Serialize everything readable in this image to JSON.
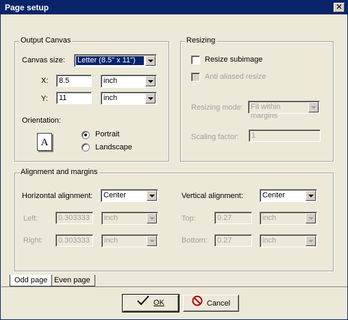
{
  "window": {
    "title": "Page setup",
    "close_glyph": "✕"
  },
  "output_canvas": {
    "legend": "Output Canvas",
    "canvas_size_label": "Canvas size:",
    "canvas_size_value": "Letter (8.5\" x 11\")",
    "x_label": "X:",
    "x_value": "8.5",
    "x_unit": "inch",
    "y_label": "Y:",
    "y_value": "11",
    "y_unit": "inch",
    "orientation_label": "Orientation:",
    "page_icon_letter": "A",
    "portrait_label": "Portrait",
    "landscape_label": "Landscape",
    "portrait_checked": true
  },
  "resizing": {
    "legend": "Resizing",
    "resize_subimage_label": "Resize subimage",
    "anti_aliased_label": "Anti aliased resize",
    "mode_label": "Resizing mode:",
    "mode_value": "Fit within margins",
    "scaling_label": "Scaling factor:",
    "scaling_value": "1"
  },
  "alignment": {
    "legend": "Alignment and margins",
    "horizontal_label": "Horizontal alignment:",
    "horizontal_value": "Center",
    "vertical_label": "Vertical alignment:",
    "vertical_value": "Center",
    "left_label": "Left:",
    "left_value": "0.303333",
    "left_unit": "inch",
    "right_label": "Right:",
    "right_value": "0.303333",
    "right_unit": "inch",
    "top_label": "Top:",
    "top_value": "0.27",
    "top_unit": "inch",
    "bottom_label": "Bottom:",
    "bottom_value": "0.27",
    "bottom_unit": "inch"
  },
  "tabs": {
    "odd": "Odd page",
    "even": "Even page"
  },
  "buttons": {
    "ok": "OK",
    "cancel": "Cancel"
  },
  "colors": {
    "title_bar": "#0a246a",
    "face": "#ece9d8",
    "disabled_text": "#a0a0a0",
    "cancel_icon": "#b00000"
  },
  "icons": {
    "ok": "checkmark-icon",
    "cancel": "no-entry-icon",
    "close": "close-icon",
    "orientation": "page-portrait-icon"
  }
}
